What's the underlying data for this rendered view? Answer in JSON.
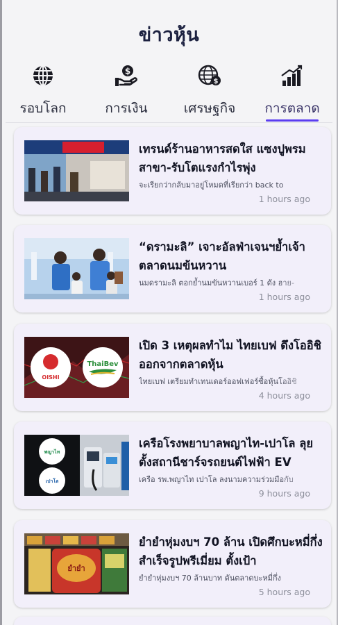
{
  "app": {
    "title": "ข่าวหุ้น"
  },
  "tabs": [
    {
      "label": "รอบโลก",
      "icon": "globe-icon",
      "active": false
    },
    {
      "label": "การเงิน",
      "icon": "money-hand-icon",
      "active": false
    },
    {
      "label": "เศรษฐกิจ",
      "icon": "economy-globe-icon",
      "active": false
    },
    {
      "label": "การตลาด",
      "icon": "bar-chart-icon",
      "active": true
    }
  ],
  "colors": {
    "accent": "#5b3df0",
    "card_bg": "#f2effa",
    "title": "#1c2140"
  },
  "news": [
    {
      "headline": "เทรนด์ร้านอาหารสดใส แซงปูพรมสาขา-รับโตแรงกำไรพุ่ง",
      "snippet": "จะเรียกว่ากลับมาอยู่โหมดที่เรียกว่า back to",
      "time": "1 hours ago",
      "image": "food-store-photo"
    },
    {
      "headline": "“ดรามะลิ” เจาะอัลฟ่าเจนฯย้ำเจ้าตลาดนมข้นหวาน",
      "snippet": "นมดรามะลิ ตอกย้ำนมข้นหวานเบอร์ 1 ดัง ฮาย-",
      "time": "1 hours ago",
      "image": "milk-brand-photo"
    },
    {
      "headline": "เปิด 3 เหตุผลทำไม ไทยเบฟ ดึงโออิชิ ออกจากตลาดหุ้น",
      "snippet": "ไทยเบฟ เตรียมทำเทนเดอร์ออฟเฟอร์ซื้อหุ้นโออิชิ",
      "time": "4 hours ago",
      "image": "oishi-thaibev-logos"
    },
    {
      "headline": "เครือโรงพยาบาลพญาไท-เปาโล ลุยตั้งสถานีชาร์จรถยนต์ไฟฟ้า EV",
      "snippet": "เครือ รพ.พญาไท เปาโล ลงนามความร่วมมือกับ",
      "time": "9 hours ago",
      "image": "ev-charger-photo"
    },
    {
      "headline": "ยำยำหุ่มงบฯ 70 ล้าน เปิดศึกบะหมี่กึ่งสำเร็จรูปพรีเมี่ยม ตั้งเป้า",
      "snippet": "ยำยำหุ่มงบฯ 70 ล้านบาท ดันตลาดบะหมี่กึ่ง",
      "time": "5 hours ago",
      "image": "instant-noodle-photo"
    }
  ]
}
